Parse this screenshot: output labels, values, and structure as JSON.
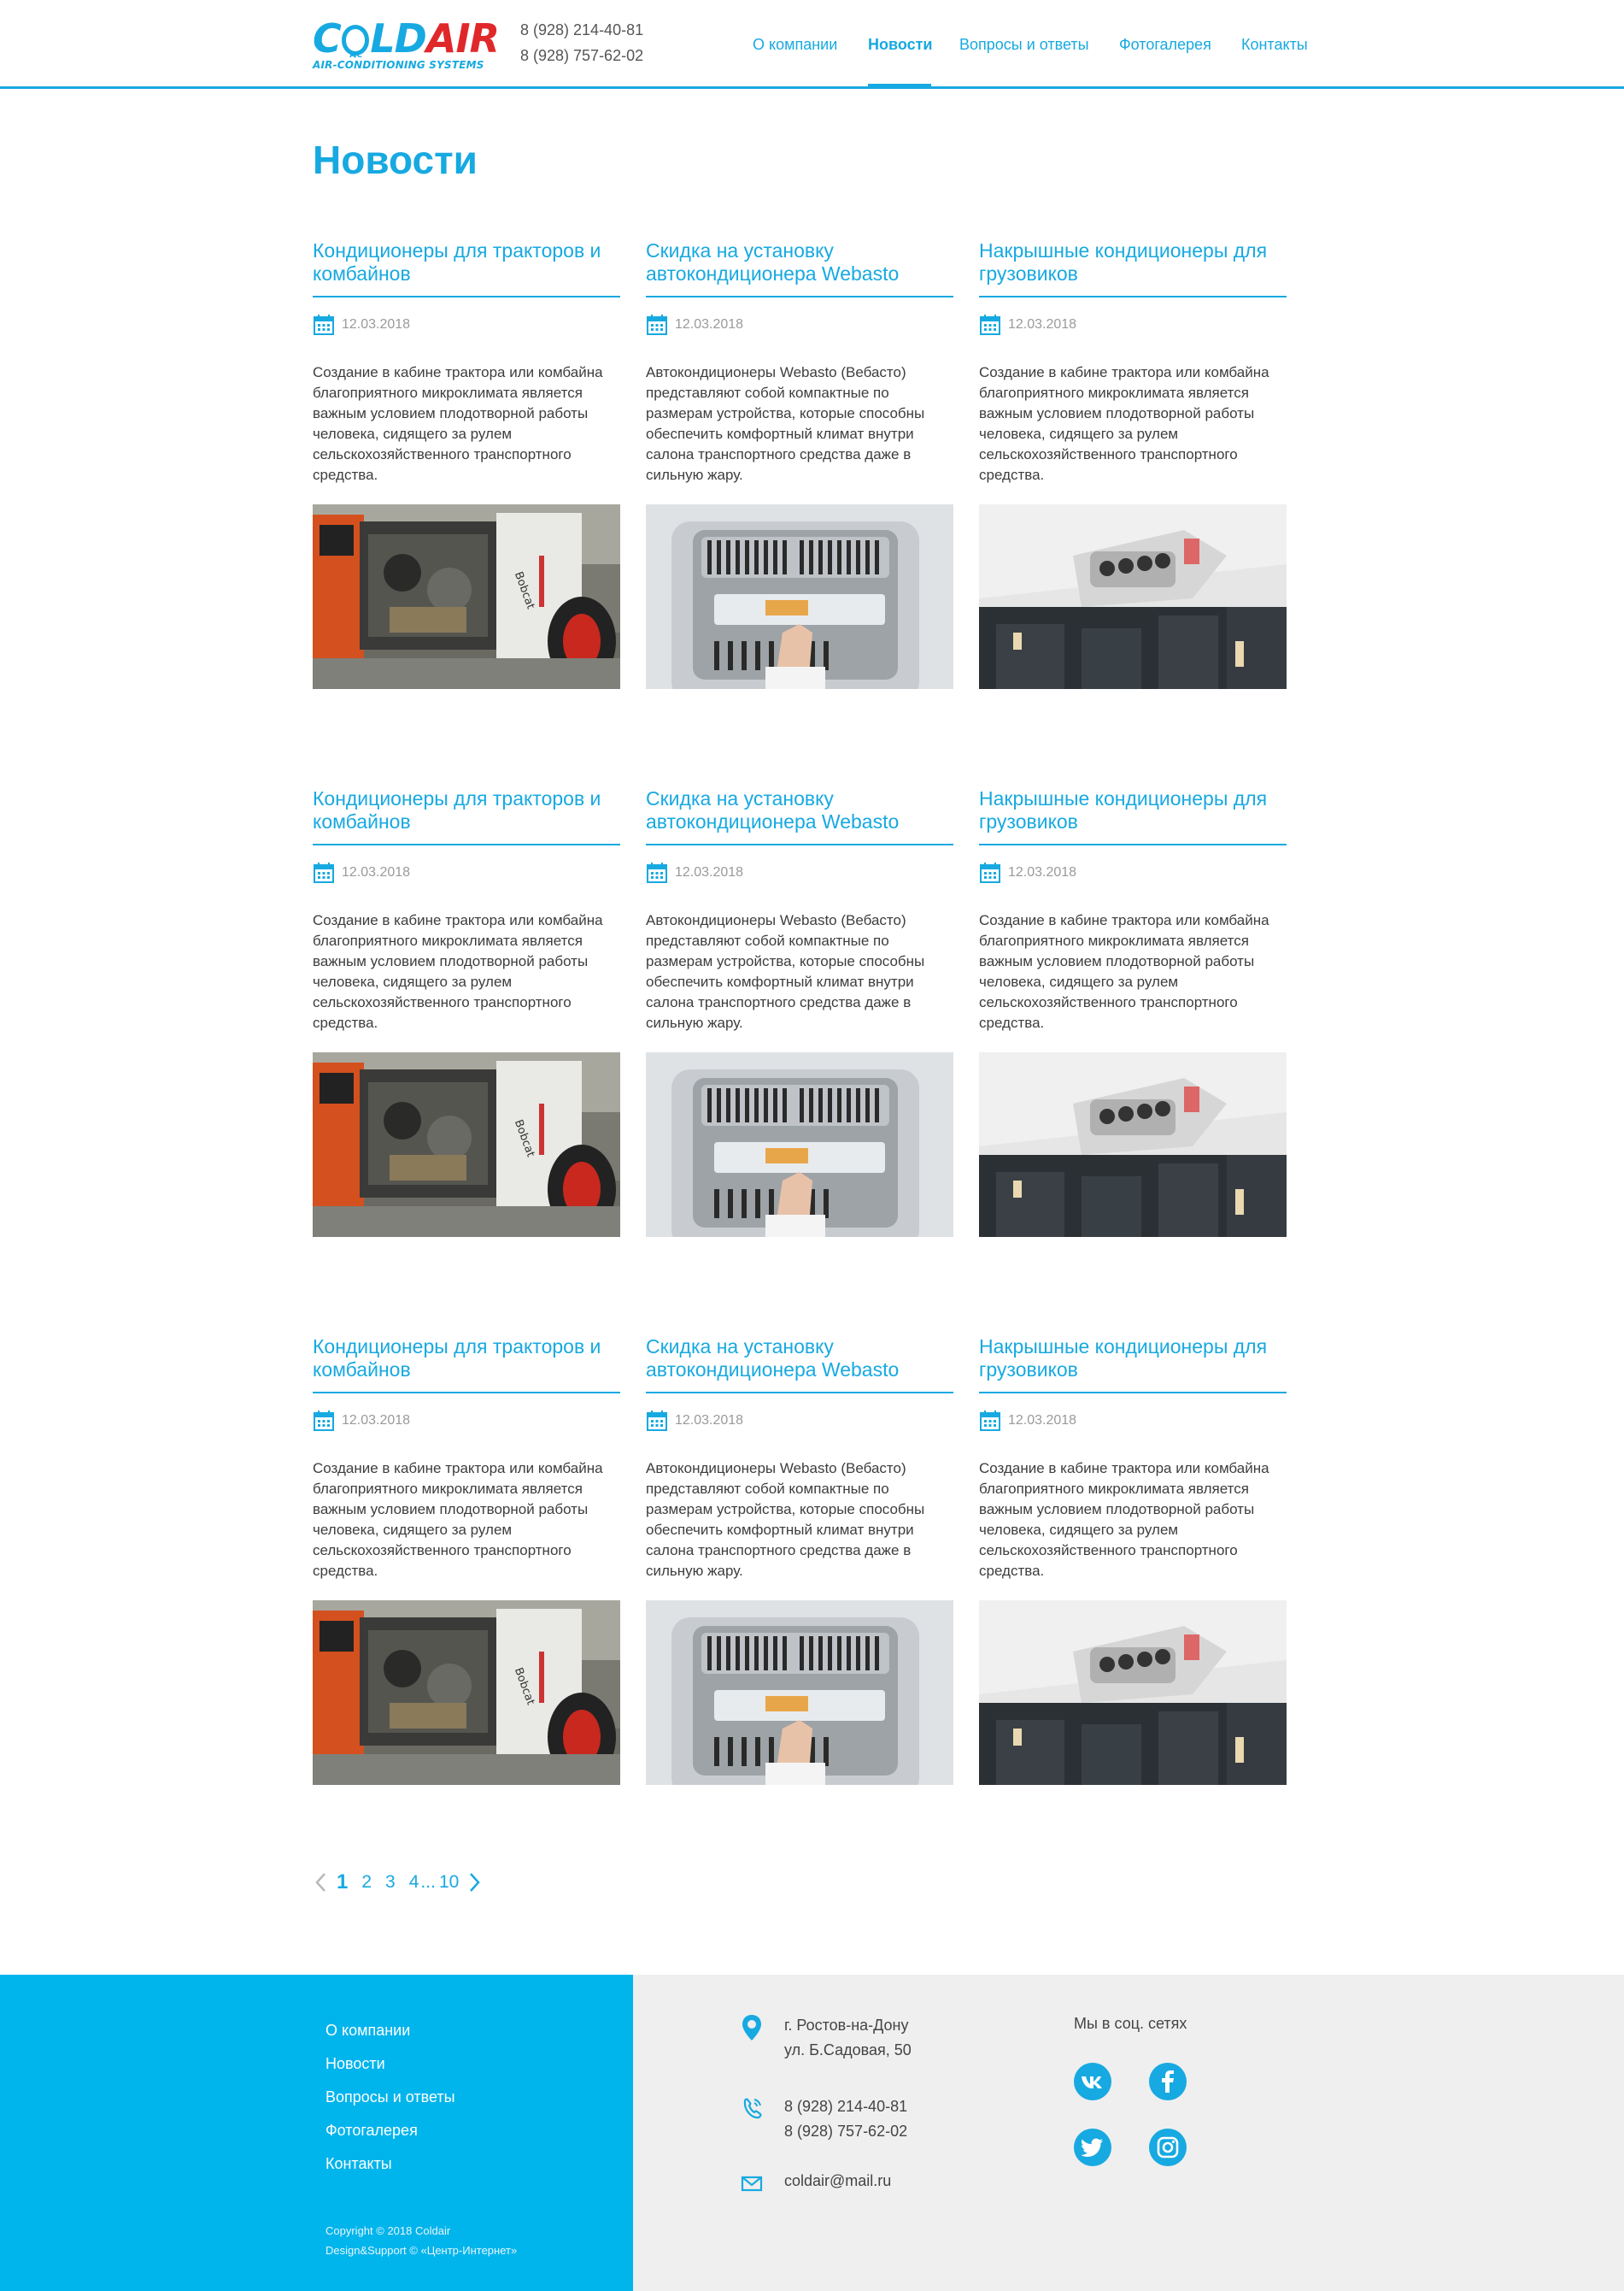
{
  "header": {
    "logo": {
      "word_cold": "COLD",
      "word_air": "AIR",
      "ac_badge": "A/C",
      "subtitle": "AIR-CONDITIONING SYSTEMS"
    },
    "phones": [
      "8 (928) 214-40-81",
      "8 (928) 757-62-02"
    ],
    "nav": [
      {
        "label": "О компании",
        "active": false
      },
      {
        "label": "Новости",
        "active": true
      },
      {
        "label": "Вопросы и ответы",
        "active": false
      },
      {
        "label": "Фотогалерея",
        "active": false
      },
      {
        "label": "Контакты",
        "active": false
      }
    ]
  },
  "main": {
    "title": "Новости",
    "news": [
      {
        "title": "Кондиционеры для тракторов и комбайнов",
        "date": "12.03.2018",
        "text": "Создание в кабине трактора или комбайна благоприятного микроклимата является важным условием плодотворной работы человека, сидящего за рулем сельскохозяйственного транспортного средства.",
        "image": "tractor"
      },
      {
        "title": "Скидка на установку автокондиционера Webasto",
        "date": "12.03.2018",
        "text": "Автокондиционеры Webasto (Вебасто) представляют собой компактные по размерам устройства, которые способны обеспечить комфортный климат внутри салона транспортного средства даже в сильную жару.",
        "image": "webasto-panel"
      },
      {
        "title": "Накрышные кондиционеры для грузовиков",
        "date": "12.03.2018",
        "text": "Создание в кабине трактора или комбайна благоприятного микроклимата является важным условием плодотворной работы человека, сидящего за рулем сельскохозяйственного транспортного средства.",
        "image": "truck-roof-unit"
      },
      {
        "title": "Кондиционеры для тракторов и комбайнов",
        "date": "12.03.2018",
        "text": "Создание в кабине трактора или комбайна благоприятного микроклимата является важным условием плодотворной работы человека, сидящего за рулем сельскохозяйственного транспортного средства.",
        "image": "tractor"
      },
      {
        "title": "Скидка на установку автокондиционера Webasto",
        "date": "12.03.2018",
        "text": "Автокондиционеры Webasto (Вебасто) представляют собой компактные по размерам устройства, которые способны обеспечить комфортный климат внутри салона транспортного средства даже в сильную жару.",
        "image": "webasto-panel"
      },
      {
        "title": "Накрышные кондиционеры для грузовиков",
        "date": "12.03.2018",
        "text": "Создание в кабине трактора или комбайна благоприятного микроклимата является важным условием плодотворной работы человека, сидящего за рулем сельскохозяйственного транспортного средства.",
        "image": "truck-roof-unit"
      },
      {
        "title": "Кондиционеры для тракторов и комбайнов",
        "date": "12.03.2018",
        "text": "Создание в кабине трактора или комбайна благоприятного микроклимата является важным условием плодотворной работы человека, сидящего за рулем сельскохозяйственного транспортного средства.",
        "image": "tractor"
      },
      {
        "title": "Скидка на установку автокондиционера Webasto",
        "date": "12.03.2018",
        "text": "Автокондиционеры Webasto (Вебасто) представляют собой компактные по размерам устройства, которые способны обеспечить комфортный климат внутри салона транспортного средства даже в сильную жару.",
        "image": "webasto-panel"
      },
      {
        "title": "Накрышные кондиционеры для грузовиков",
        "date": "12.03.2018",
        "text": "Создание в кабине трактора или комбайна благоприятного микроклимата является важным условием плодотворной работы человека, сидящего за рулем сельскохозяйственного транспортного средства.",
        "image": "truck-roof-unit"
      }
    ],
    "pagination": {
      "pages": [
        "1",
        "2",
        "3",
        "4"
      ],
      "ellipsis": "...",
      "last": "10",
      "current": "1"
    }
  },
  "footer": {
    "nav": [
      "О компании",
      "Новости",
      "Вопросы и ответы",
      "Фотогалерея",
      "Контакты"
    ],
    "copyright": [
      "Copyright © 2018 Coldair",
      "Design&Support © «Центр-Интернет»"
    ],
    "address": [
      "г. Ростов-на-Дону",
      "ул. Б.Садовая, 50"
    ],
    "phones": [
      "8 (928) 214-40-81",
      "8 (928) 757-62-02"
    ],
    "email": "coldair@mail.ru",
    "social_title": "Мы в соц. сетях",
    "social": [
      "vk-icon",
      "facebook-icon",
      "twitter-icon",
      "instagram-icon"
    ]
  },
  "colors": {
    "accent": "#17a9e1",
    "footer_blue": "#00b4ec",
    "logo_red": "#e0282b",
    "footer_gray": "#efefef"
  }
}
